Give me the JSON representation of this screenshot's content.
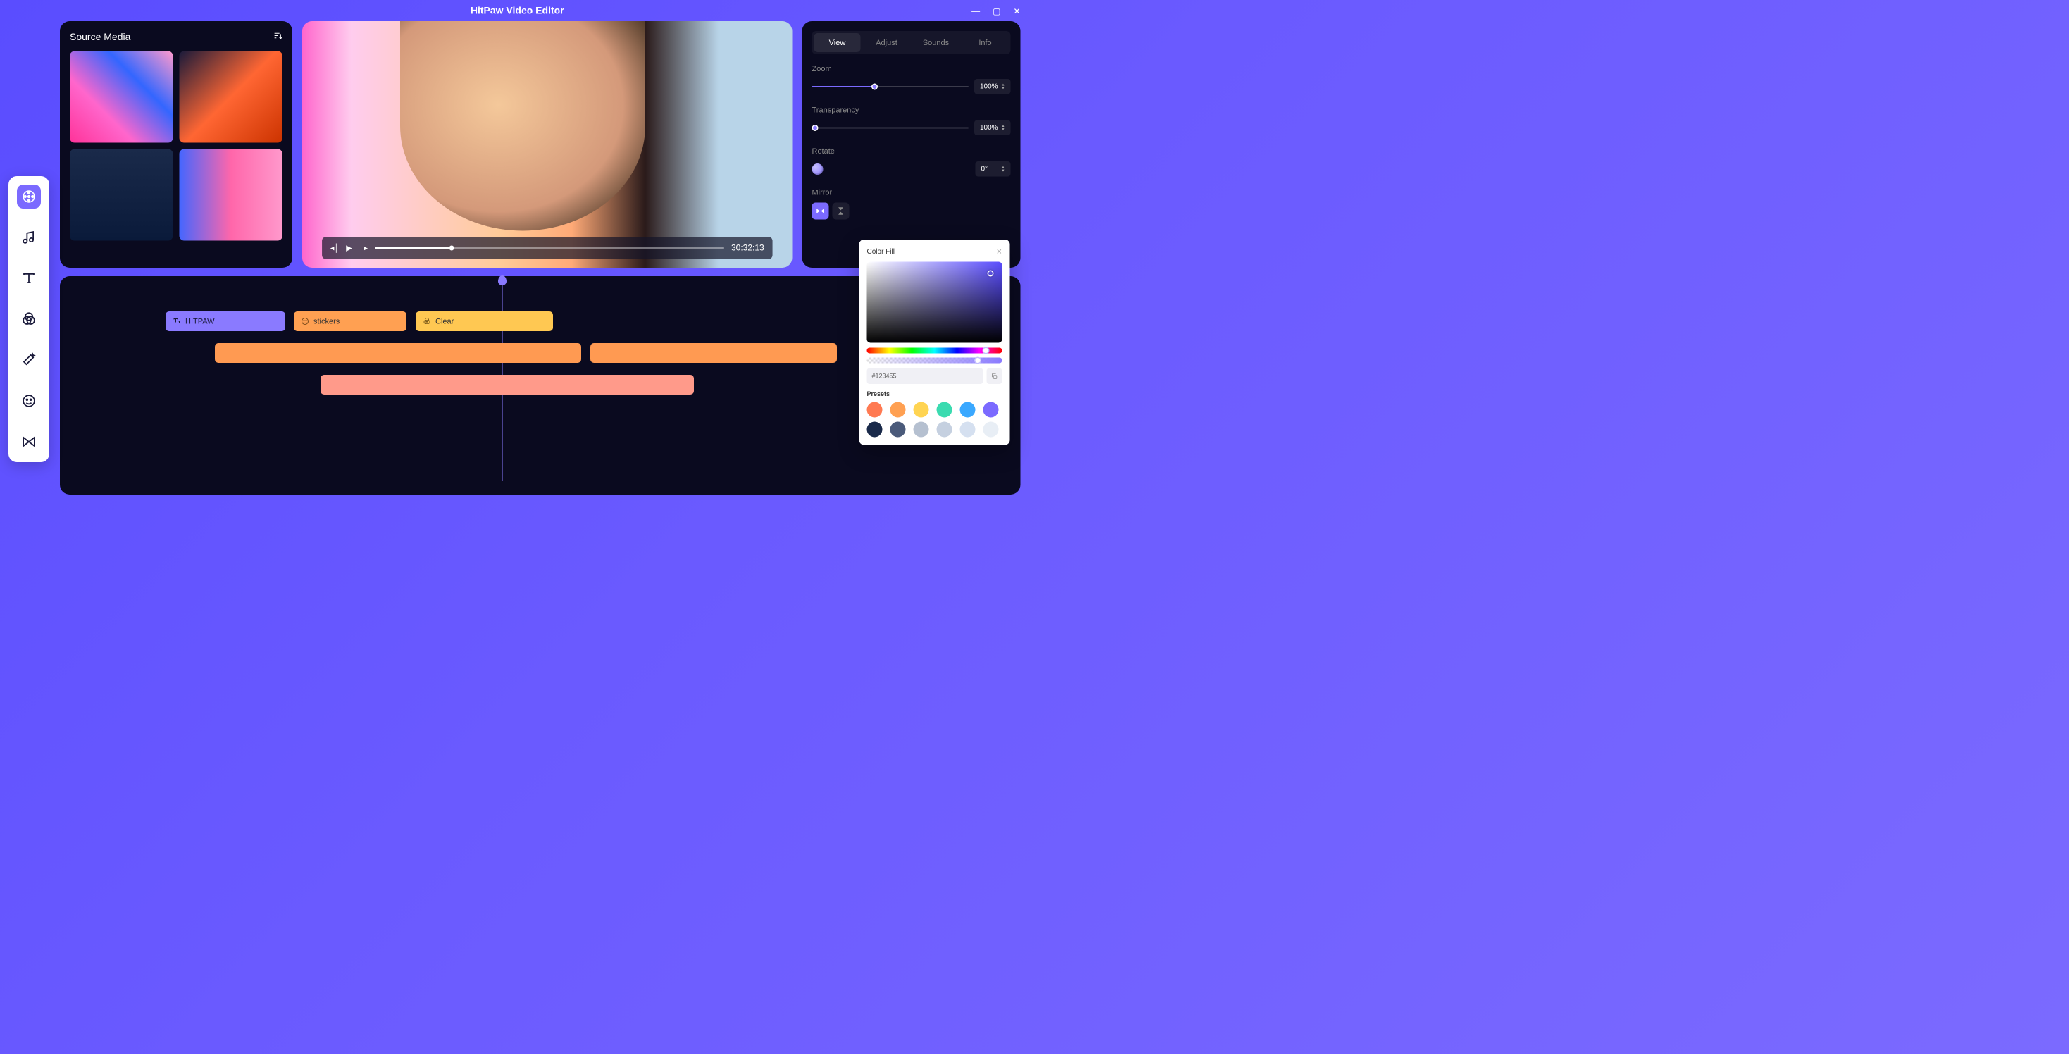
{
  "app_title": "HitPaw Video Editor",
  "source": {
    "title": "Source Media"
  },
  "player": {
    "time": "30:32:13"
  },
  "props": {
    "tabs": [
      "View",
      "Adjust",
      "Sounds",
      "Info"
    ],
    "zoom": {
      "label": "Zoom",
      "value": "100%",
      "fill": 40
    },
    "transparency": {
      "label": "Transparency",
      "value": "100%",
      "fill": 2
    },
    "rotate": {
      "label": "Rotate",
      "value": "0°"
    },
    "mirror": {
      "label": "Mirror"
    }
  },
  "timeline": {
    "clips": [
      {
        "label": "HITPAW"
      },
      {
        "label": "stickers"
      },
      {
        "label": "Clear"
      }
    ]
  },
  "color": {
    "title": "Color Fill",
    "hex": "#123455",
    "presets_label": "Presets",
    "presets": [
      "#ff7a52",
      "#ffa052",
      "#ffd452",
      "#3adbb0",
      "#3aa8ff",
      "#7b6aff",
      "#1a2a4a",
      "#4a5a7a",
      "#b5c0d0",
      "#c5d0e0",
      "#d5e0f0",
      "#e8eef5"
    ]
  }
}
